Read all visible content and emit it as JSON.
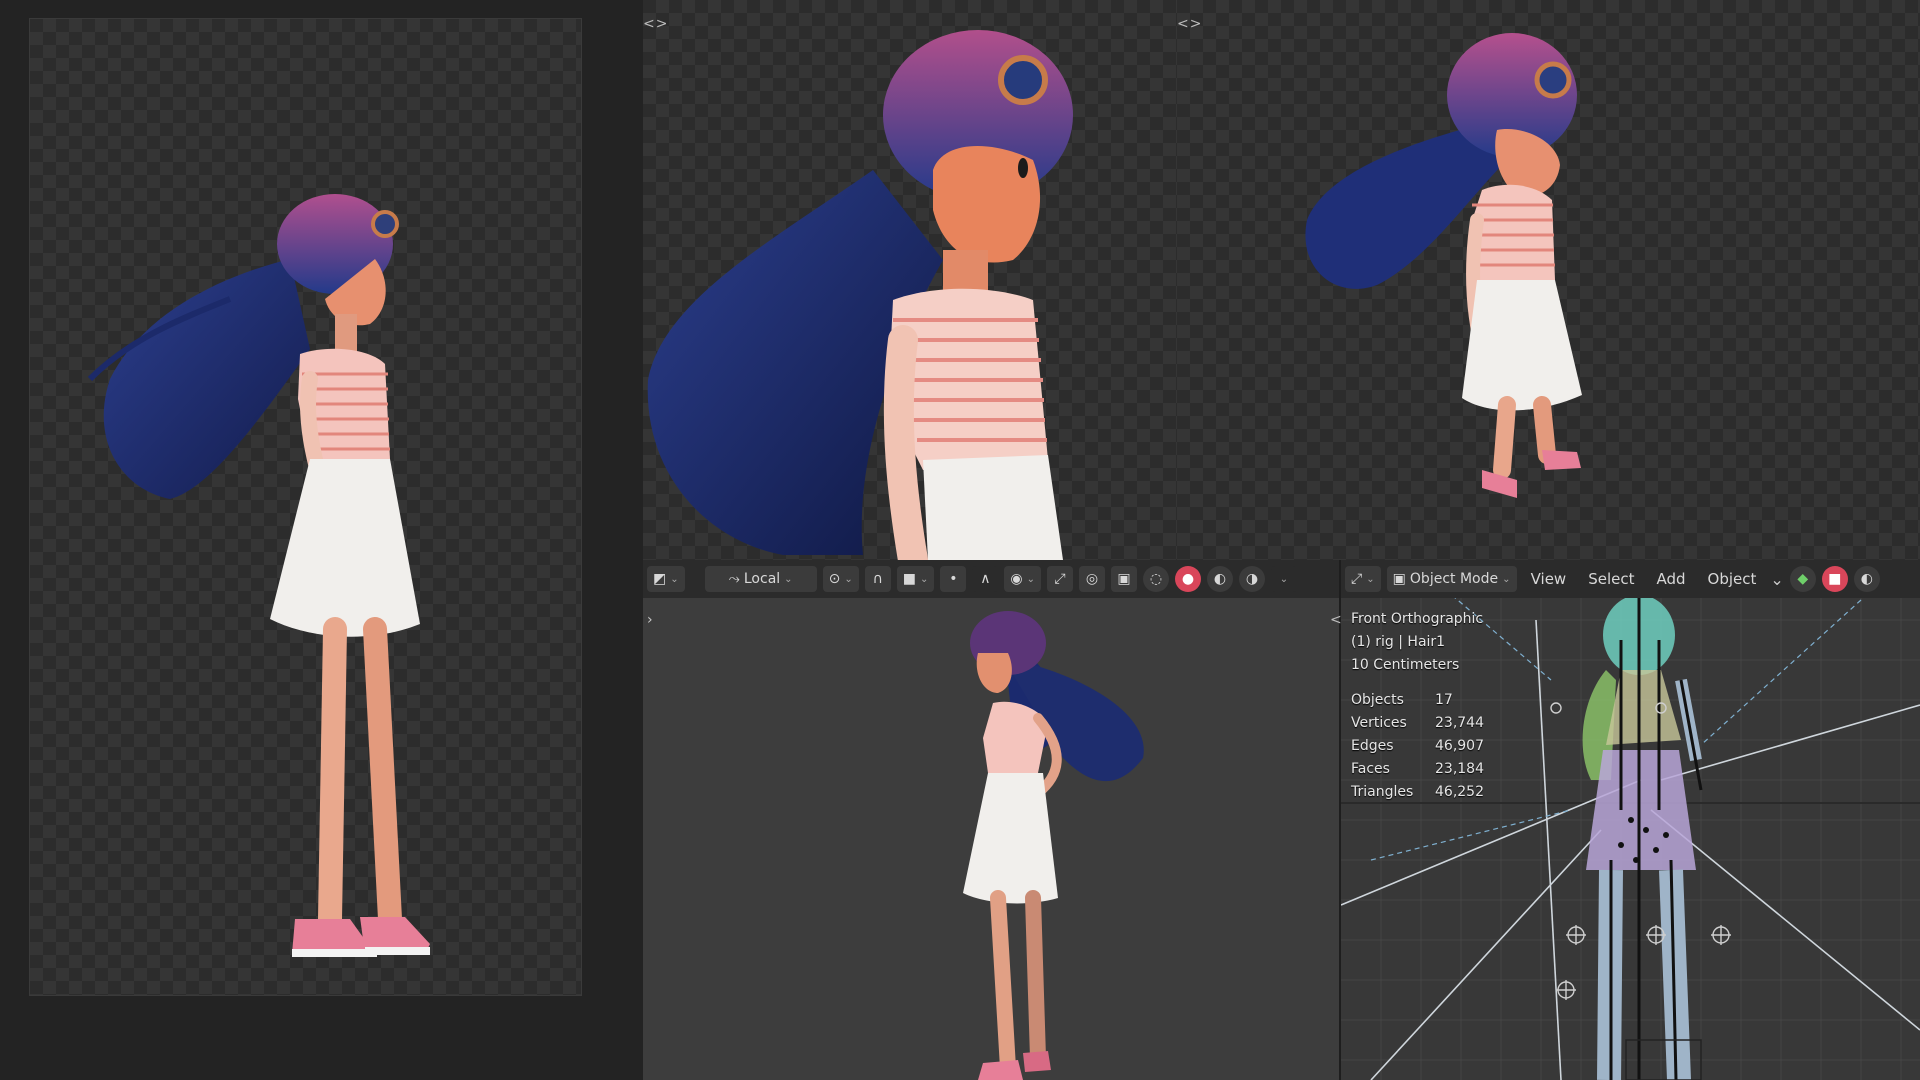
{
  "splitter_icon": "<>",
  "toolbar_mid": {
    "transform_orientation": "Local",
    "icons": [
      "editor-type-icon",
      "orientation-icon",
      "pivot-icon",
      "snap-icon",
      "snap-target-icon",
      "proportional-icon",
      "falloff-icon",
      "visibility-icon",
      "gizmo-icon",
      "overlay-icon",
      "xray-icon",
      "wireframe-shading-icon",
      "solid-shading-icon",
      "material-shading-icon",
      "rendered-shading-icon"
    ]
  },
  "toolbar_right": {
    "mode": "Object Mode",
    "menus": [
      "View",
      "Select",
      "Add",
      "Object"
    ]
  },
  "viewport_info": {
    "view_name": "Front Orthographic",
    "collection": "(1) rig  | Hair1",
    "scale": "10 Centimeters"
  },
  "stats": [
    {
      "label": "Objects",
      "value": "17"
    },
    {
      "label": "Vertices",
      "value": "23,744"
    },
    {
      "label": "Edges",
      "value": "46,907"
    },
    {
      "label": "Faces",
      "value": "23,184"
    },
    {
      "label": "Triangles",
      "value": "46,252"
    }
  ],
  "colors": {
    "accent_active": "#d9465a",
    "helmet": "#7a2f6e",
    "hair": "#1e2d6e",
    "shirt": "#f2b1a8",
    "skirt": "#f1efec",
    "skin": "#e7906f",
    "shoes": "#e77f98"
  }
}
